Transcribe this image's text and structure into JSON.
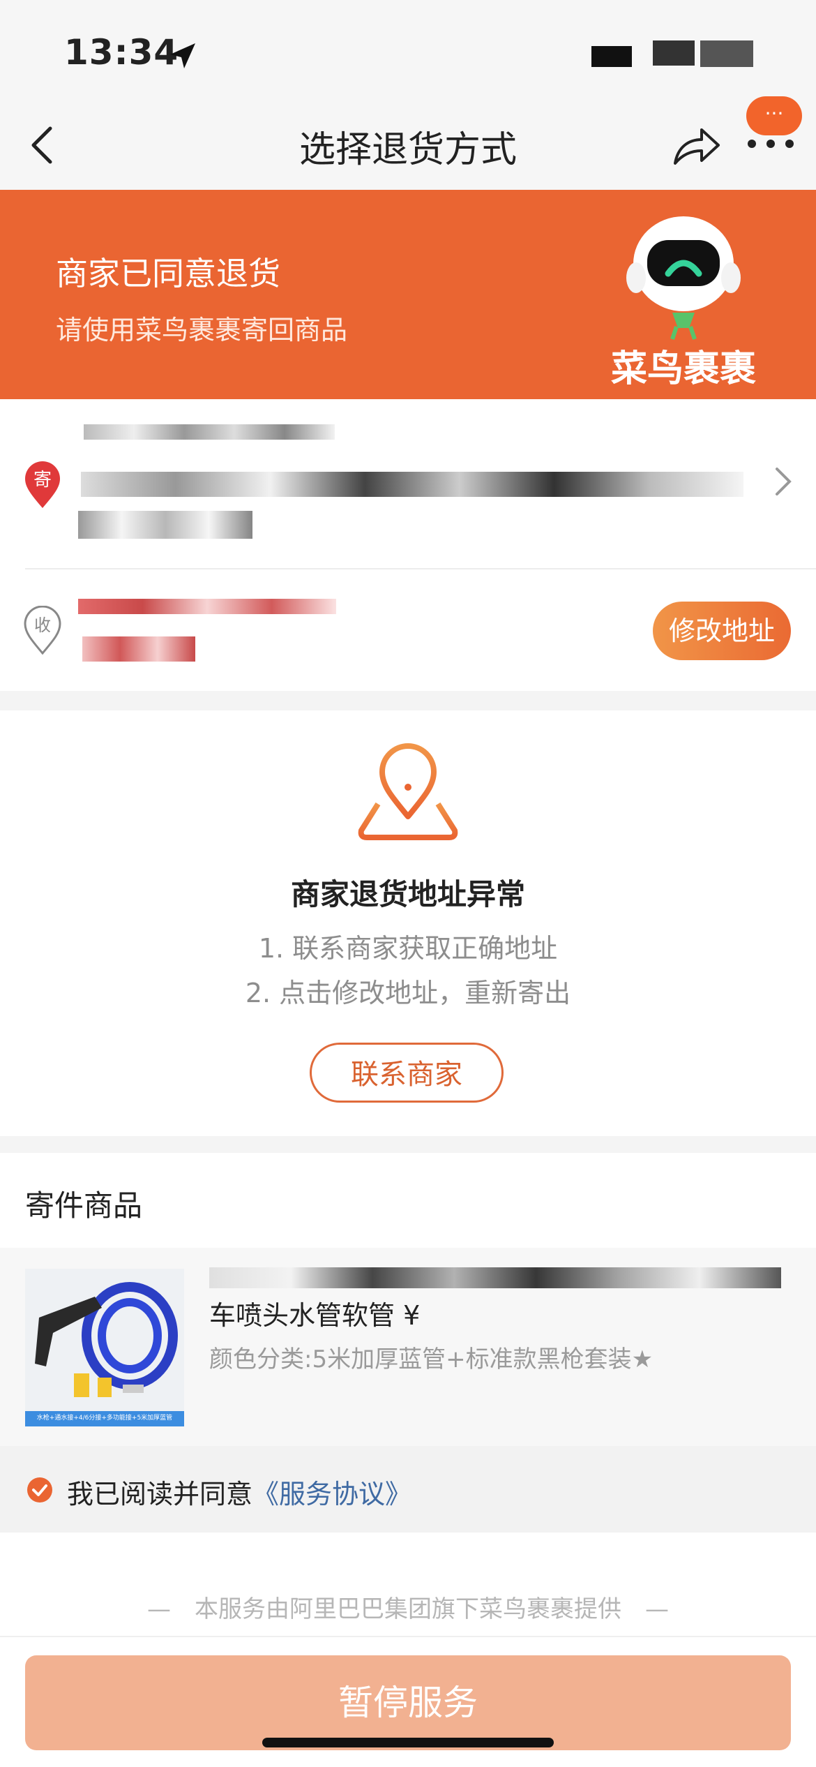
{
  "status_bar": {
    "time": "13:34"
  },
  "nav": {
    "title": "选择退货方式",
    "bubble": "···"
  },
  "banner": {
    "title": "商家已同意退货",
    "subtitle": "请使用菜鸟裹裹寄回商品",
    "logo_text": "菜鸟裹裹",
    "bg_color": "#ea6532"
  },
  "address": {
    "send_badge": "寄",
    "receive_badge": "收",
    "edit_button": "修改地址"
  },
  "abnormal": {
    "title": "商家退货地址异常",
    "steps": [
      "1. 联系商家获取正确地址",
      "2. 点击修改地址，重新寄出"
    ],
    "contact_button": "联系商家"
  },
  "goods": {
    "section_label": "寄件商品",
    "name": "车喷头水管软管 ¥",
    "sku": "颜色分类:5米加厚蓝管+标准款黑枪套装★",
    "thumb_caption": "水枪+通水接+4/6分接+多功能接+5米加厚蓝管"
  },
  "agreement": {
    "prefix": "我已阅读并同意",
    "link": "《服务协议》"
  },
  "footer": {
    "note": "—　本服务由阿里巴巴集团旗下菜鸟裹裹提供　—",
    "stop_button": "暂停服务"
  },
  "colors": {
    "accent": "#ea6532",
    "link": "#3f6aa3",
    "disabled_button": "#f2b191"
  }
}
